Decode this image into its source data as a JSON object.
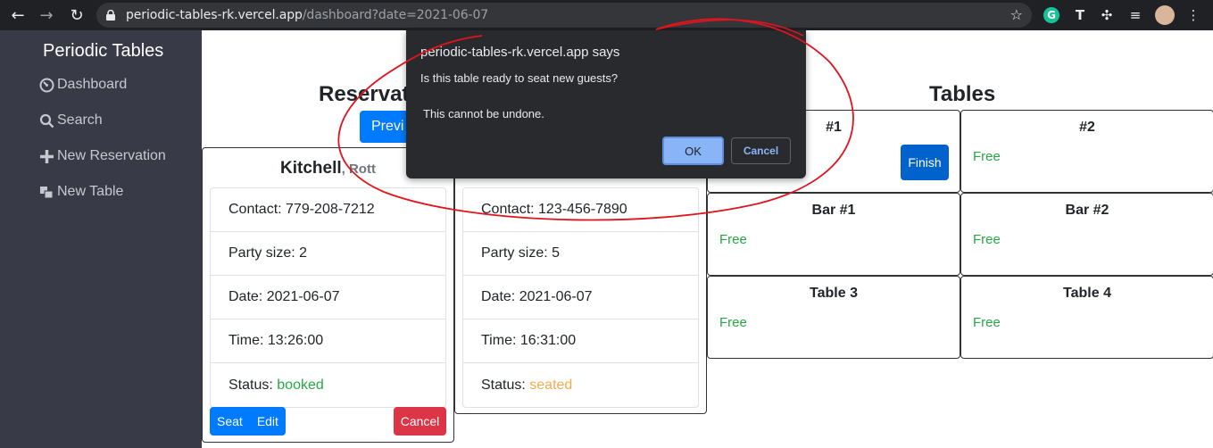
{
  "browser": {
    "url_host": "periodic-tables-rk.vercel.app",
    "url_path": "/dashboard?date=2021-06-07"
  },
  "sidebar": {
    "title": "Periodic Tables",
    "items": [
      {
        "label": "Dashboard",
        "icon": "dashboard-icon"
      },
      {
        "label": "Search",
        "icon": "search-icon"
      },
      {
        "label": "New Reservation",
        "icon": "plus-icon"
      },
      {
        "label": "New Table",
        "icon": "table-icon"
      }
    ]
  },
  "main": {
    "reservations_heading": "Reservati",
    "previous_label": "Previ",
    "tables_heading": "Tables",
    "reservations": [
      {
        "last_name": "Kitchell",
        "first_name": ", Rott",
        "contact": "Contact: 779-208-7212",
        "party_size": "Party size: 2",
        "date": "Date: 2021-06-07",
        "time": "Time: 13:26:00",
        "status_label": "Status: ",
        "status": "booked",
        "seat_label": "Seat",
        "edit_label": "Edit",
        "cancel_label": "Cancel"
      },
      {
        "contact": "Contact: 123-456-7890",
        "party_size": "Party size: 5",
        "date": "Date: 2021-06-07",
        "time": "Time: 16:31:00",
        "status_label": "Status: ",
        "status": "seated"
      }
    ],
    "tables": [
      {
        "name": "#1",
        "finish_label": "Finish"
      },
      {
        "name": "#2",
        "status": "Free"
      },
      {
        "name": "Bar #1",
        "status": "Free"
      },
      {
        "name": "Bar #2",
        "status": "Free"
      },
      {
        "name": "Table 3",
        "status": "Free"
      },
      {
        "name": "Table 4",
        "status": "Free"
      }
    ]
  },
  "dialog": {
    "title": "periodic-tables-rk.vercel.app says",
    "message": "Is this table ready to seat new guests?",
    "message2": "This cannot be undone.",
    "ok_label": "OK",
    "cancel_label": "Cancel"
  },
  "colors": {
    "sidebar_bg": "#393a47",
    "primary": "#007bff",
    "danger": "#dc3545",
    "free": "#28a745",
    "annotation": "#e0141e"
  }
}
